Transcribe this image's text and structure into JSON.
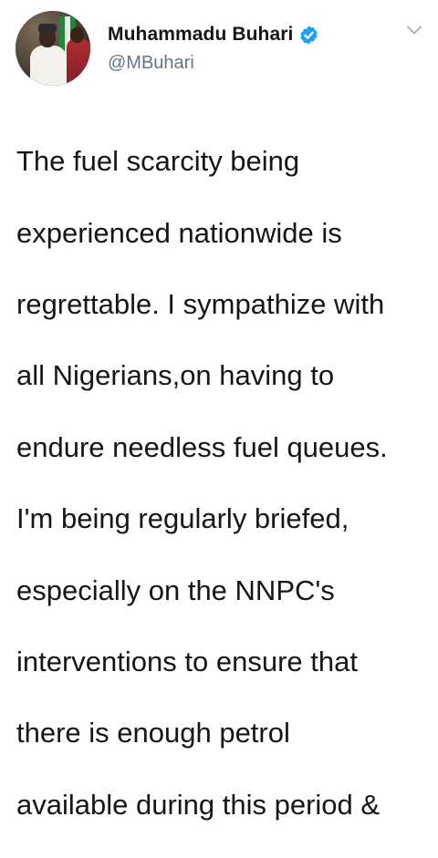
{
  "tweet": {
    "author": {
      "display_name": "Muhammadu Buhari",
      "handle": "@MBuhari",
      "verified": true
    },
    "icons": {
      "verified": "verified-badge-icon",
      "menu": "chevron-down-icon"
    },
    "colors": {
      "verified_blue": "#1da1f2",
      "handle_gray": "#657786",
      "text": "#14171a"
    },
    "text_lines": [
      "The fuel scarcity being",
      "experienced nationwide is",
      "regrettable. I sympathize with",
      "all Nigerians,on having to",
      "endure needless fuel queues.",
      "I'm being regularly briefed,",
      "especially on the NNPC's",
      "interventions to ensure that",
      "there is enough petrol",
      "available during this period &"
    ]
  }
}
